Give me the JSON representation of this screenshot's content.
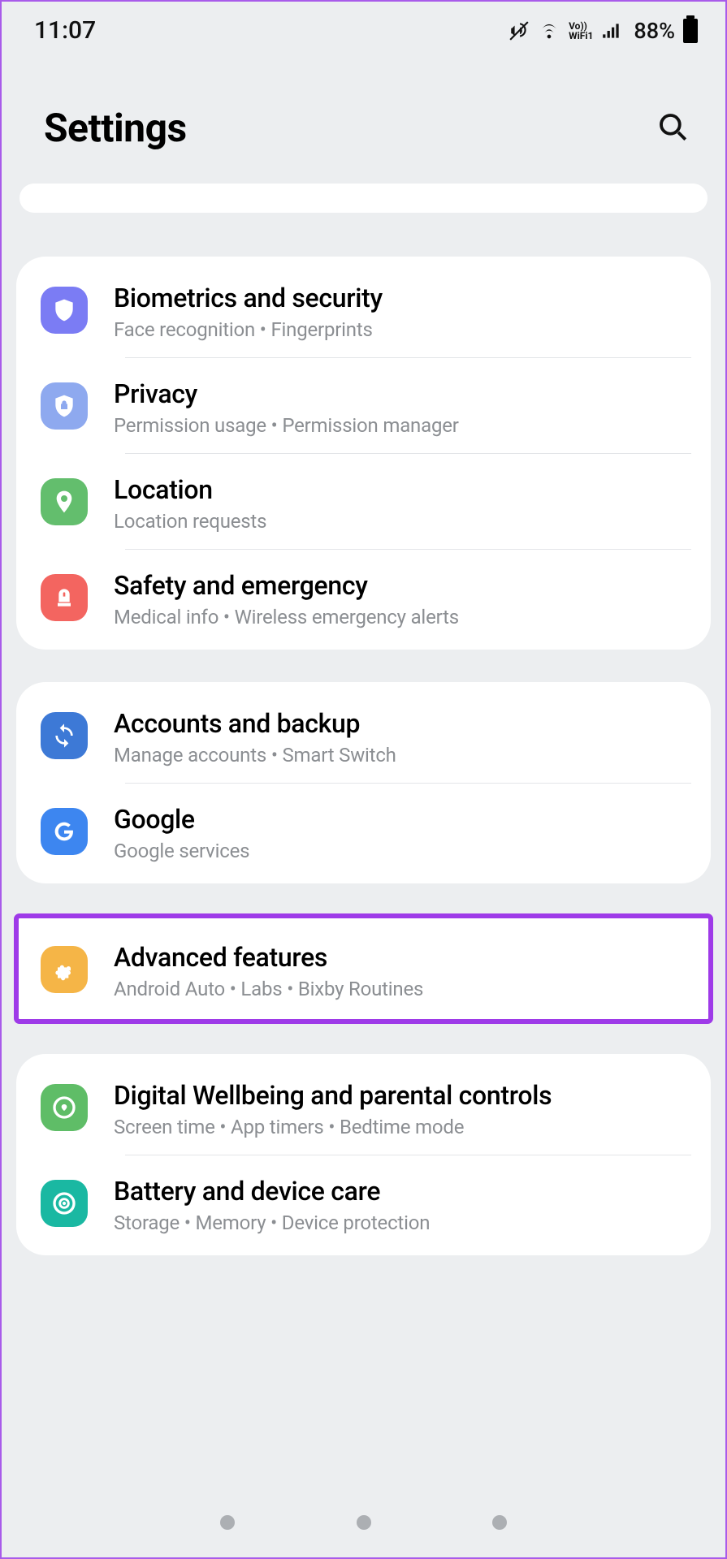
{
  "status": {
    "time": "11:07",
    "battery": "88%"
  },
  "header": {
    "title": "Settings"
  },
  "groups": [
    [
      {
        "title": "Biometrics and security",
        "sub": "Face recognition  •  Fingerprints"
      },
      {
        "title": "Privacy",
        "sub": "Permission usage  •  Permission manager"
      },
      {
        "title": "Location",
        "sub": "Location requests"
      },
      {
        "title": "Safety and emergency",
        "sub": "Medical info  •  Wireless emergency alerts"
      }
    ],
    [
      {
        "title": "Accounts and backup",
        "sub": "Manage accounts  •  Smart Switch"
      },
      {
        "title": "Google",
        "sub": "Google services"
      }
    ],
    [
      {
        "title": "Advanced features",
        "sub": "Android Auto  •  Labs  •  Bixby Routines"
      }
    ],
    [
      {
        "title": "Digital Wellbeing and parental controls",
        "sub": "Screen time  •  App timers  •  Bedtime mode"
      },
      {
        "title": "Battery and device care",
        "sub": "Storage  •  Memory  •  Device protection"
      }
    ]
  ]
}
